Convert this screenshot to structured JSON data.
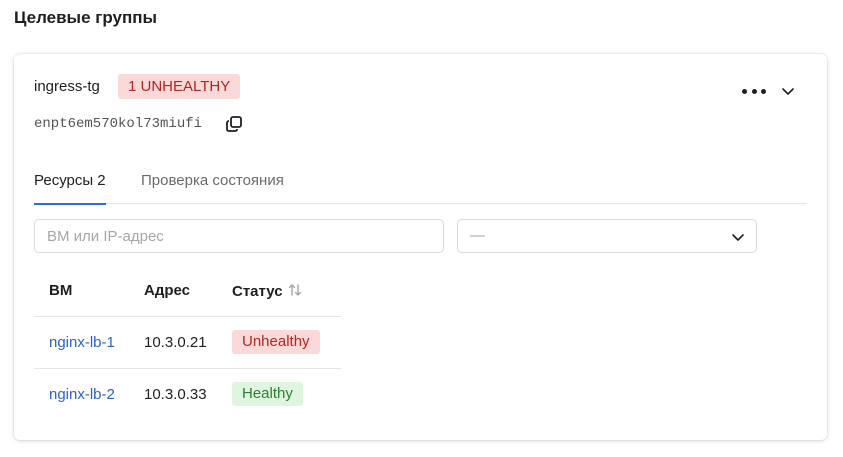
{
  "page": {
    "title": "Целевые группы"
  },
  "target_group": {
    "name": "ingress-tg",
    "health_badge": "1 UNHEALTHY",
    "id": "enpt6em570kol73miufi",
    "icons": {
      "menu": "more-dots-icon",
      "collapse": "chevron-down-icon",
      "copy": "copy-icon"
    }
  },
  "tabs": [
    {
      "label": "Ресурсы 2",
      "active": true
    },
    {
      "label": "Проверка состояния",
      "active": false
    }
  ],
  "filters": {
    "search_placeholder": "ВМ или IP-адрес",
    "search_value": "",
    "status_select_value": "—"
  },
  "table": {
    "columns": [
      "ВМ",
      "Адрес",
      "Статус"
    ],
    "rows": [
      {
        "vm": "nginx-lb-1",
        "address": "10.3.0.21",
        "status": "Unhealthy"
      },
      {
        "vm": "nginx-lb-2",
        "address": "10.3.0.33",
        "status": "Healthy"
      }
    ]
  },
  "colors": {
    "accent": "#2a6fd6",
    "link": "#2a63c4",
    "unhealthy_bg": "#fbd9d9",
    "unhealthy_text": "#b3261e",
    "healthy_bg": "#dff5df",
    "healthy_text": "#2e7d32"
  }
}
